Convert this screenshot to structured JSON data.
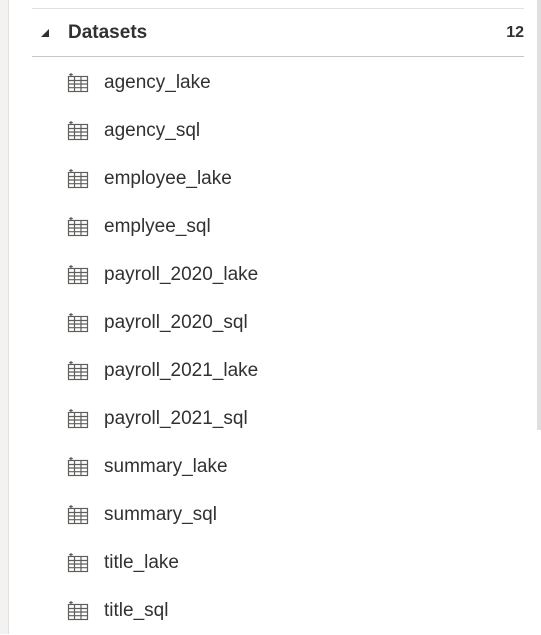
{
  "section": {
    "title": "Datasets",
    "count": "12",
    "expanded": true
  },
  "datasets": [
    {
      "label": "agency_lake"
    },
    {
      "label": "agency_sql"
    },
    {
      "label": "employee_lake"
    },
    {
      "label": "emplyee_sql"
    },
    {
      "label": "payroll_2020_lake"
    },
    {
      "label": "payroll_2020_sql"
    },
    {
      "label": "payroll_2021_lake"
    },
    {
      "label": "payroll_2021_sql"
    },
    {
      "label": "summary_lake"
    },
    {
      "label": "summary_sql"
    },
    {
      "label": "title_lake"
    },
    {
      "label": "title_sql"
    }
  ],
  "icons": {
    "caret": "caret-down-icon",
    "dataset": "table-icon"
  },
  "colors": {
    "text": "#323130",
    "icon": "#605e5c",
    "divider": "#c8c6c4"
  }
}
